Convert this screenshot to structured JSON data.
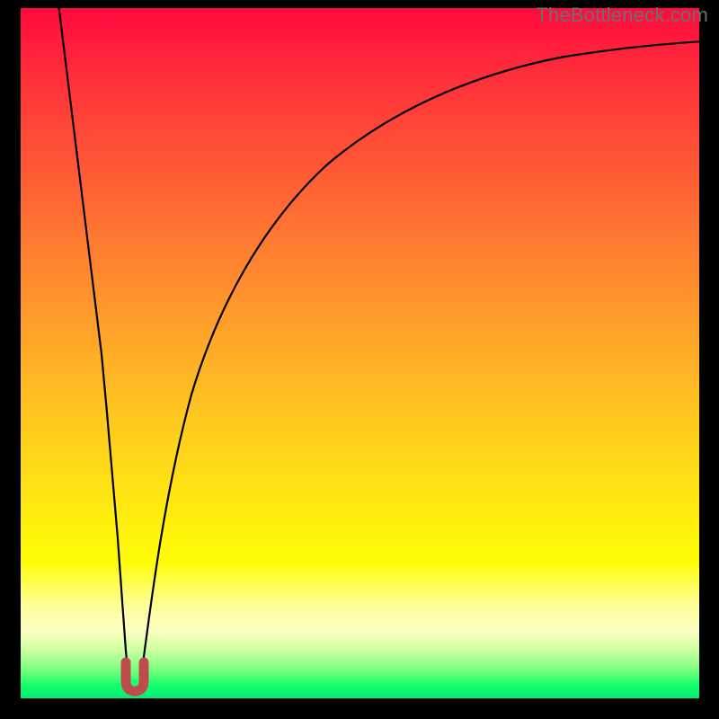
{
  "watermark": "TheBottleneck.com",
  "chart_data": {
    "type": "line",
    "title": "",
    "xlabel": "",
    "ylabel": "",
    "xlim": [
      0,
      100
    ],
    "ylim": [
      0,
      100
    ],
    "grid": false,
    "axes_visible": false,
    "background": "vertical-gradient red→orange→yellow→green",
    "note": "Two black curves descending to a common minimum at x≈15 (y≈0). Left branch is steep and nearly linear from the top-left corner; right branch is a concave curve rising from the minimum and asymptotically approaching y≈100 toward the right edge. A small red U-shaped marker sits at the minimum.",
    "series": [
      {
        "name": "left-branch",
        "x": [
          3,
          4,
          5,
          6,
          7,
          8,
          9,
          10,
          11,
          12,
          13,
          14,
          15
        ],
        "y": [
          100,
          92,
          85,
          77,
          69,
          62,
          54,
          46,
          38,
          31,
          23,
          12,
          2
        ]
      },
      {
        "name": "right-branch",
        "x": [
          15,
          16,
          17,
          18,
          20,
          22,
          25,
          28,
          32,
          36,
          40,
          45,
          50,
          55,
          60,
          65,
          70,
          75,
          80,
          85,
          90,
          95,
          100
        ],
        "y": [
          2,
          8,
          14,
          20,
          30,
          38,
          48,
          55,
          62,
          67,
          71,
          75,
          78,
          81,
          83,
          85,
          86.5,
          88,
          89,
          90,
          91,
          92,
          92.5
        ]
      }
    ],
    "marker": {
      "name": "min-u-marker",
      "x": 15,
      "y": 2,
      "shape": "U",
      "color": "#c14b4b"
    }
  }
}
